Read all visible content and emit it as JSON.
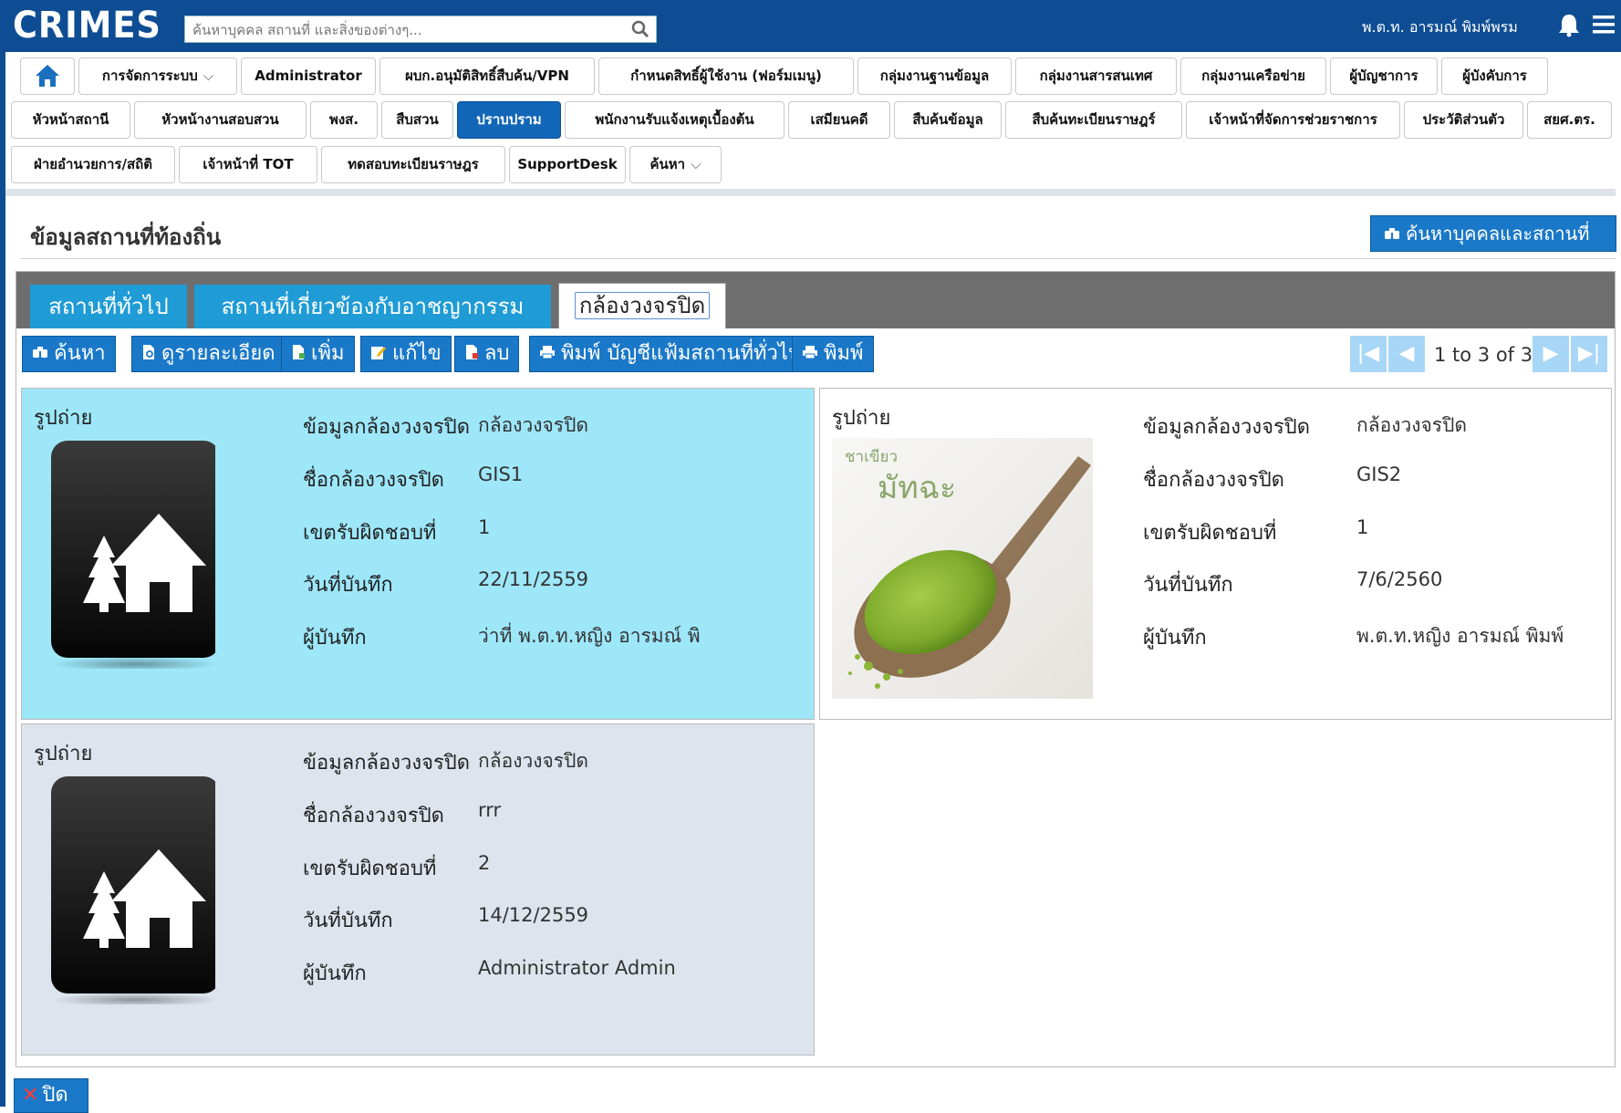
{
  "app": {
    "logo": "CRIMES",
    "search_placeholder": "ค้นหาบุคคล สถานที่ และสิ่งของต่างๆ...",
    "user": "พ.ต.ท. อารมณ์ พิมพ์พรม"
  },
  "nav": {
    "row1": [
      "การจัดการระบบ",
      "Administrator",
      "ผบก.อนุมัติสิทธิ์สืบค้น/VPN",
      "กำหนดสิทธิ์ผู้ใช้งาน (ฟอร์มเมนู)",
      "กลุ่มงานฐานข้อมูล",
      "กลุ่มงานสารสนเทศ",
      "กลุ่มงานเครือข่าย",
      "ผู้บัญชาการ",
      "ผู้บังคับการ"
    ],
    "row2": [
      "หัวหน้าสถานี",
      "หัวหน้างานสอบสวน",
      "พงส.",
      "สืบสวน",
      "ปราบปราม",
      "พนักงานรับแจ้งเหตุเบื้องต้น",
      "เสมียนคดี",
      "สืบค้นข้อมูล",
      "สืบค้นทะเบียนราษฎร์",
      "เจ้าหน้าที่จัดการช่วยราชการ",
      "ประวัติส่วนตัว",
      "สยศ.ตร."
    ],
    "row3": [
      "ฝ่ายอำนวยการ/สถิติ",
      "เจ้าหน้าที่ TOT",
      "ทดสอบทะเบียนราษฎร",
      "SupportDesk",
      "ค้นหา"
    ],
    "active": "ปราบปราม"
  },
  "page": {
    "title": "ข้อมูลสถานที่ท้องถิ่น",
    "search_people_button": "ค้นหาบุคคลและสถานที่"
  },
  "tabs": [
    "สถานที่ทั่วไป",
    "สถานที่เกี่ยวข้องกับอาชญากรรม",
    "กล้องวงจรปิด"
  ],
  "active_tab": "กล้องวงจรปิด",
  "toolbar": {
    "search": "ค้นหา",
    "detail": "ดูรายละเอียด",
    "add": "เพิ่ม",
    "edit": "แก้ไข",
    "delete": "ลบ",
    "print_list": "พิมพ์ บัญชีแฟ้มสถานที่ทั่วไป",
    "print": "พิมพ์"
  },
  "pager": {
    "info": "1 to 3 of 3"
  },
  "labels": {
    "photo": "รูปถ่าย",
    "cctv_info": "ข้อมูลกล้องวงจรปิด",
    "cctv_name": "ชื่อกล้องวงจรปิด",
    "zone": "เขตรับผิดชอบที่",
    "record_date": "วันที่บันทึก",
    "recorder": "ผู้บันทึก"
  },
  "records": [
    {
      "cctv_info": "กล้องวงจรปิด",
      "cctv_name": "GIS1",
      "zone": "1",
      "record_date": "22/11/2559",
      "recorder": "ว่าที่ พ.ต.ท.หญิง อารมณ์ พิ",
      "photo": "place-placeholder-icon"
    },
    {
      "cctv_info": "กล้องวงจรปิด",
      "cctv_name": "GIS2",
      "zone": "1",
      "record_date": "7/6/2560",
      "recorder": "พ.ต.ท.หญิง อารมณ์ พิมพ์",
      "photo": "matcha-photo",
      "photo_text_small": "ชาเขียว",
      "photo_text_big": "มัทฉะ"
    },
    {
      "cctv_info": "กล้องวงจรปิด",
      "cctv_name": "rrr",
      "zone": "2",
      "record_date": "14/12/2559",
      "recorder": "Administrator Admin",
      "photo": "place-placeholder-icon"
    }
  ],
  "close_button": "ปิด",
  "colors": {
    "header_blue": "#0e4d94",
    "button_blue": "#1a78c8",
    "tab_blue": "#1f9bd6",
    "selected_card": "#9de7f9",
    "alt_card": "#dde4ee"
  }
}
